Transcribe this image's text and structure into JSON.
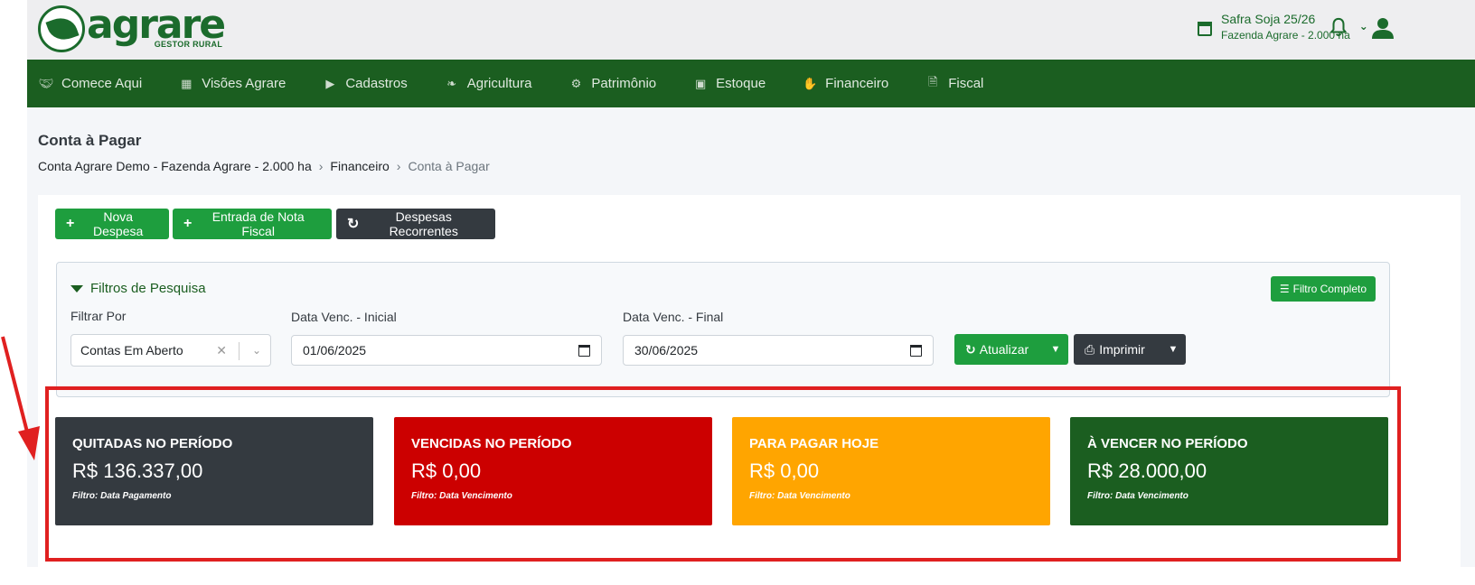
{
  "brand": {
    "name": "agrare",
    "tagline": "GESTOR RURAL",
    "color": "#1b6b2c"
  },
  "header": {
    "safra_title": "Safra Soja 25/26",
    "safra_subtitle": "Fazenda Agrare - 2.000 ha"
  },
  "nav": {
    "items": [
      {
        "label": "Comece Aqui",
        "icon": "handshake-icon"
      },
      {
        "label": "Visões Agrare",
        "icon": "grid-icon"
      },
      {
        "label": "Cadastros",
        "icon": "tags-icon"
      },
      {
        "label": "Agricultura",
        "icon": "leaf-icon"
      },
      {
        "label": "Patrimônio",
        "icon": "tractor-icon"
      },
      {
        "label": "Estoque",
        "icon": "boxes-icon"
      },
      {
        "label": "Financeiro",
        "icon": "hand-money-icon"
      },
      {
        "label": "Fiscal",
        "icon": "invoice-icon"
      }
    ],
    "background": "#1b5e20"
  },
  "page": {
    "title": "Conta à Pagar",
    "breadcrumb": [
      "Conta Agrare Demo - Fazenda Agrare - 2.000 ha",
      "Financeiro",
      "Conta à Pagar"
    ]
  },
  "actions": {
    "nova_despesa": "Nova Despesa",
    "entrada_nota": "Entrada de Nota Fiscal",
    "despesas_recorrentes": "Despesas Recorrentes"
  },
  "filters": {
    "title": "Filtros de Pesquisa",
    "filtro_completo": "Filtro Completo",
    "filtrar_por_label": "Filtrar Por",
    "filtrar_por_value": "Contas Em Aberto",
    "data_inicial_label": "Data Venc. - Inicial",
    "data_inicial_value": "01/06/2025",
    "data_final_label": "Data Venc. - Final",
    "data_final_value": "30/06/2025",
    "atualizar": "Atualizar",
    "imprimir": "Imprimir"
  },
  "kpis": [
    {
      "title": "QUITADAS NO PERÍODO",
      "value": "R$ 136.337,00",
      "note": "Filtro: Data Pagamento",
      "color": "#343a40"
    },
    {
      "title": "VENCIDAS NO PERÍODO",
      "value": "R$ 0,00",
      "note": "Filtro: Data Vencimento",
      "color": "#cc0000"
    },
    {
      "title": "PARA PAGAR HOJE",
      "value": "R$ 0,00",
      "note": "Filtro: Data Vencimento",
      "color": "#ffa500"
    },
    {
      "title": "À VENCER NO PERÍODO",
      "value": "R$ 28.000,00",
      "note": "Filtro: Data Vencimento",
      "color": "#1b5e20"
    }
  ],
  "annotation": {
    "color": "#e02020"
  }
}
